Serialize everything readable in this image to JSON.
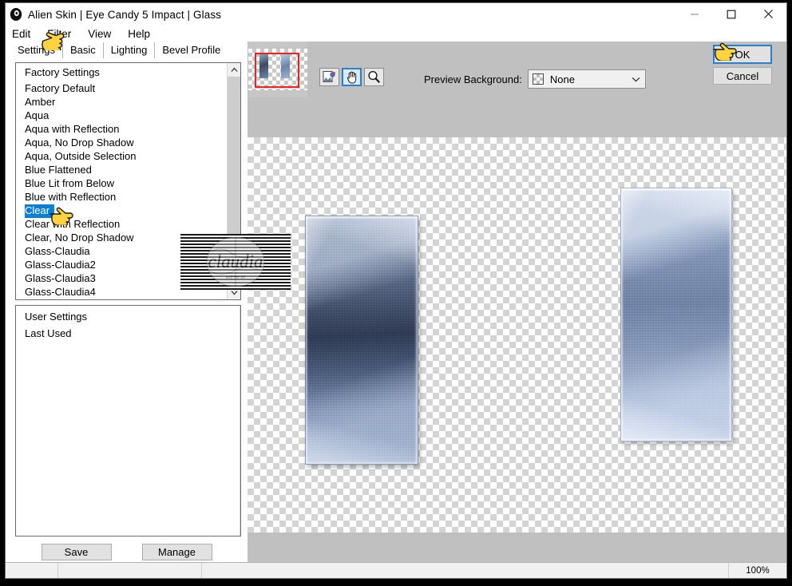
{
  "window": {
    "title": "Alien Skin | Eye Candy 5 Impact | Glass",
    "icon": "app-icon",
    "controls": {
      "minimize": "minimize-icon",
      "maximize": "maximize-icon",
      "close": "close-icon"
    }
  },
  "menubar": {
    "items": [
      {
        "label": "Edit"
      },
      {
        "label": "Filter"
      },
      {
        "label": "View"
      },
      {
        "label": "Help"
      }
    ]
  },
  "tabs": [
    {
      "label": "Settings",
      "active": true
    },
    {
      "label": "Basic",
      "active": false
    },
    {
      "label": "Lighting",
      "active": false
    },
    {
      "label": "Bevel Profile",
      "active": false
    }
  ],
  "presets": {
    "group_header": "Factory Settings",
    "selected": "Clear",
    "items": [
      "Factory Default",
      "Amber",
      "Aqua",
      "Aqua with Reflection",
      "Aqua, No Drop Shadow",
      "Aqua, Outside Selection",
      "Blue Flattened",
      "Blue Lit from Below",
      "Blue with Reflection",
      "Clear",
      "Clear with Reflection",
      "Clear, No Drop Shadow",
      "Glass-Claudia",
      "Glass-Claudia2",
      "Glass-Claudia3",
      "Glass-Claudia4"
    ]
  },
  "user_settings": {
    "items": [
      "User Settings",
      "Last Used"
    ]
  },
  "buttons": {
    "save": "Save",
    "manage": "Manage",
    "ok": "OK",
    "cancel": "Cancel"
  },
  "toolbar": {
    "tools": [
      {
        "name": "color-picker-icon",
        "active": false
      },
      {
        "name": "hand-pan-icon",
        "active": true
      },
      {
        "name": "magnifier-zoom-icon",
        "active": false
      }
    ],
    "preview_background": {
      "label": "Preview Background:",
      "value": "None",
      "swatch": "checkerboard-swatch",
      "arrow": "chevron-down-icon"
    },
    "navigator": {
      "name": "navigator-thumbnail",
      "viewport_color": "#f02020"
    }
  },
  "statusbar": {
    "cell1": "",
    "cell2": "",
    "cell3": "",
    "zoom": "100%"
  },
  "watermark": {
    "text": "claudia"
  },
  "colors": {
    "accent": "#2b7fd0",
    "selection": "#0b7fd4",
    "panel": "#c0c0c0",
    "button": "#e1e1e1",
    "viewport_marker": "#f02020"
  },
  "preview_images": [
    {
      "name": "glass-preview-left",
      "tone": "dark-blue-grey"
    },
    {
      "name": "glass-preview-right",
      "tone": "light-blue"
    }
  ]
}
